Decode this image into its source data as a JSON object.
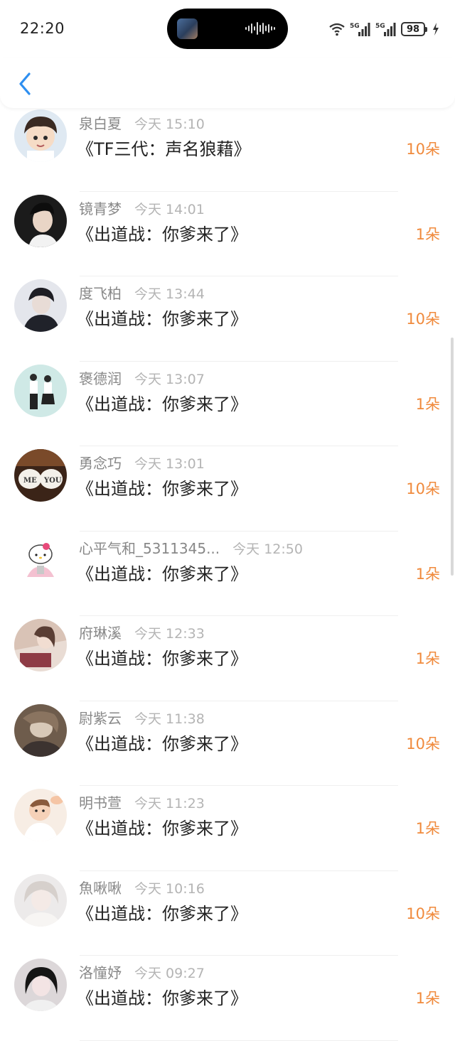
{
  "status_bar": {
    "time": "22:20",
    "battery": "98",
    "network_1": "5G",
    "network_2": "5G"
  },
  "colors": {
    "accent": "#2e8ff0",
    "count": "#f08a3c",
    "name": "#888888",
    "time": "#b4b4b4"
  },
  "rows": [
    {
      "name": "泉白夏",
      "time": "今天 15:10",
      "title": "《TF三代：声名狼藉》",
      "count": "10朵"
    },
    {
      "name": "镜青梦",
      "time": "今天 14:01",
      "title": "《出道战：你爹来了》",
      "count": "1朵"
    },
    {
      "name": "度飞柏",
      "time": "今天 13:44",
      "title": "《出道战：你爹来了》",
      "count": "10朵"
    },
    {
      "name": "褒德润",
      "time": "今天 13:07",
      "title": "《出道战：你爹来了》",
      "count": "1朵"
    },
    {
      "name": "勇念巧",
      "time": "今天 13:01",
      "title": "《出道战：你爹来了》",
      "count": "10朵"
    },
    {
      "name": "心平气和_5311345...",
      "time": "今天 12:50",
      "title": "《出道战：你爹来了》",
      "count": "1朵"
    },
    {
      "name": "府琳溪",
      "time": "今天 12:33",
      "title": "《出道战：你爹来了》",
      "count": "1朵"
    },
    {
      "name": "尉紫云",
      "time": "今天 11:38",
      "title": "《出道战：你爹来了》",
      "count": "10朵"
    },
    {
      "name": "明书萱",
      "time": "今天 11:23",
      "title": "《出道战：你爹来了》",
      "count": "1朵"
    },
    {
      "name": "魚啾啾",
      "time": "今天 10:16",
      "title": "《出道战：你爹来了》",
      "count": "10朵"
    },
    {
      "name": "洛憧妤",
      "time": "今天 09:27",
      "title": "《出道战：你爹来了》",
      "count": "1朵"
    }
  ]
}
